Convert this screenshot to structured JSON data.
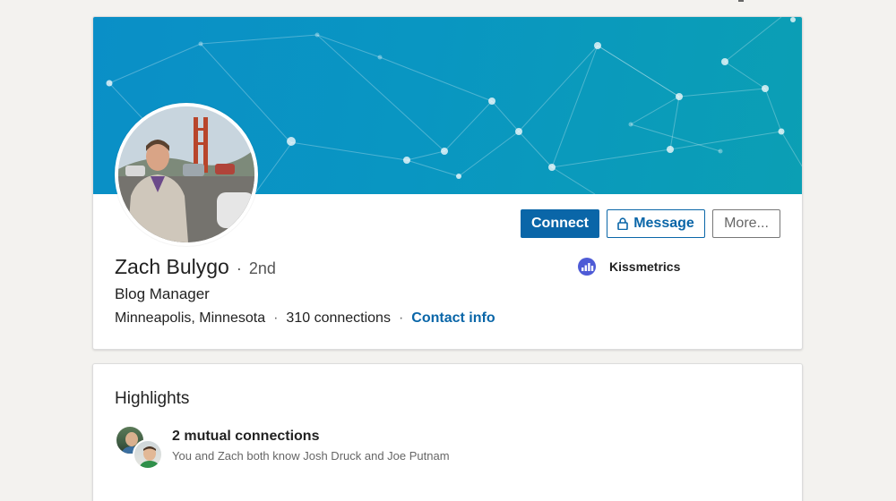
{
  "profile": {
    "name": "Zach Bulygo",
    "degree": "2nd",
    "separator": "·",
    "headline": "Blog Manager",
    "location": "Minneapolis, Minnesota",
    "connections": "310 connections",
    "contact_info": "Contact info",
    "company": "Kissmetrics"
  },
  "actions": {
    "connect": "Connect",
    "message": "Message",
    "more": "More..."
  },
  "highlights": {
    "title": "Highlights",
    "mutual_title": "2 mutual connections",
    "mutual_sub": "You and Zach both know Josh Druck and Joe Putnam"
  },
  "colors": {
    "primary": "#0a66a8",
    "banner_start": "#0a8fc7",
    "banner_end": "#0b9fb4",
    "company_logo": "#4e5bd6"
  },
  "icons": {
    "lock": "lock-icon",
    "company_logo": "kissmetrics-logo-icon"
  }
}
